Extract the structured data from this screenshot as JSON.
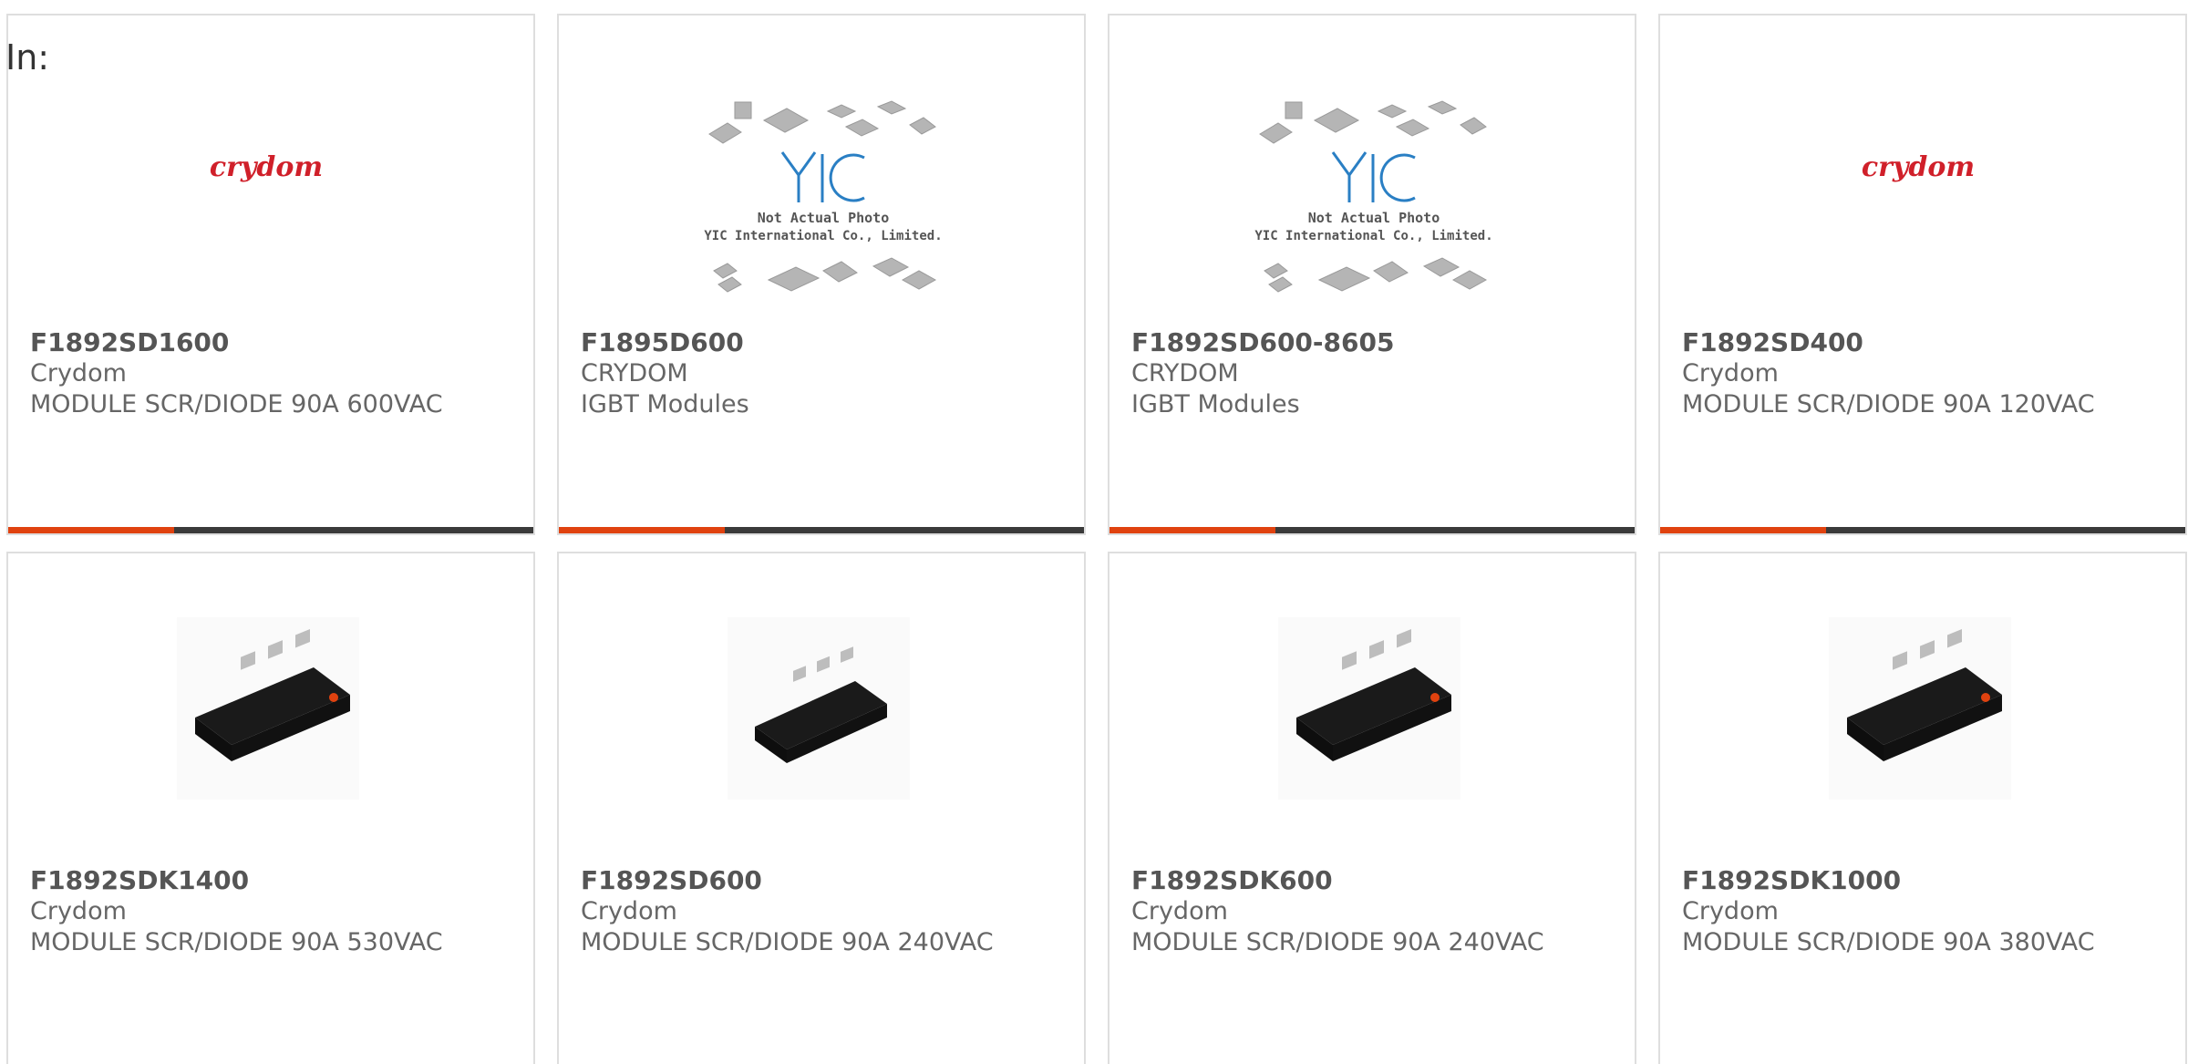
{
  "header": {
    "label": "In:"
  },
  "colors": {
    "accent_bar": "#e0420f",
    "bar_dark": "#3a3a3a",
    "crydom_red": "#d0202a",
    "yic_blue": "#2a7fc4"
  },
  "products": [
    {
      "part_number": "F1892SD1600",
      "manufacturer": "Crydom",
      "description": "MODULE SCR/DIODE 90A 600VAC",
      "image": "crydom-logo",
      "logo_text": "crydom"
    },
    {
      "part_number": "F1895D600",
      "manufacturer": "CRYDOM",
      "description": "IGBT Modules",
      "image": "not-actual-photo",
      "photo_caption_1": "Not Actual Photo",
      "photo_caption_2": "YIC International Co., Limited."
    },
    {
      "part_number": "F1892SD600-8605",
      "manufacturer": "CRYDOM",
      "description": "IGBT Modules",
      "image": "not-actual-photo",
      "photo_caption_1": "Not Actual Photo",
      "photo_caption_2": "YIC International Co., Limited."
    },
    {
      "part_number": "F1892SD400",
      "manufacturer": "Crydom",
      "description": "MODULE SCR/DIODE 90A 120VAC",
      "image": "crydom-logo",
      "logo_text": "crydom"
    },
    {
      "part_number": "F1892SDK1400",
      "manufacturer": "Crydom",
      "description": "MODULE SCR/DIODE 90A 530VAC",
      "image": "module-photo"
    },
    {
      "part_number": "F1892SD600",
      "manufacturer": "Crydom",
      "description": "MODULE SCR/DIODE 90A 240VAC",
      "image": "module-photo"
    },
    {
      "part_number": "F1892SDK600",
      "manufacturer": "Crydom",
      "description": "MODULE SCR/DIODE 90A 240VAC",
      "image": "module-photo"
    },
    {
      "part_number": "F1892SDK1000",
      "manufacturer": "Crydom",
      "description": "MODULE SCR/DIODE 90A 380VAC",
      "image": "module-photo"
    }
  ]
}
